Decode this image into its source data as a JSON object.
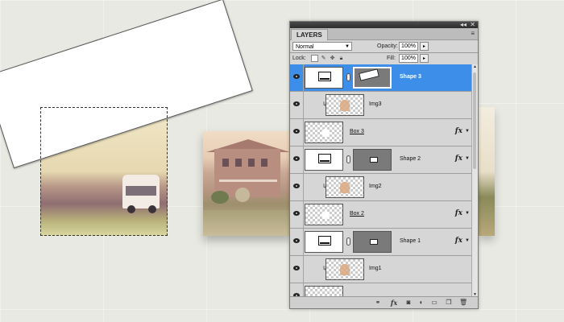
{
  "panel": {
    "tab_label": "LAYERS",
    "topbar_controls": [
      "◂◂",
      "✕"
    ],
    "menu_icon": "≡",
    "blend_mode": "Normal",
    "opacity_label": "Opacity:",
    "opacity_value": "100%",
    "lock_label": "Lock:",
    "fill_label": "Fill:",
    "fill_value": "100%",
    "lock_icons": [
      "lock-transparent-icon",
      "lock-brush-icon",
      "lock-position-icon",
      "lock-all-icon"
    ],
    "bottom_icons": [
      "link-icon",
      "fx-icon",
      "mask-icon",
      "adjustment-icon",
      "group-folder-icon",
      "new-layer-icon",
      "trash-icon"
    ]
  },
  "layers": [
    {
      "name": "Shape 3",
      "selected": true,
      "type": "shape",
      "has_mask": true,
      "fx": false
    },
    {
      "name": "Img3",
      "selected": false,
      "type": "image",
      "clipped": true,
      "fx": false
    },
    {
      "name": "Box 3",
      "selected": false,
      "type": "box",
      "fx": true
    },
    {
      "name": "Shape 2",
      "selected": false,
      "type": "shape",
      "has_mask": true,
      "fx": true
    },
    {
      "name": "Img2",
      "selected": false,
      "type": "image",
      "clipped": true,
      "fx": false
    },
    {
      "name": "Box 2",
      "selected": false,
      "type": "box",
      "fx": true
    },
    {
      "name": "Shape 1",
      "selected": false,
      "type": "shape",
      "has_mask": true,
      "fx": true
    },
    {
      "name": "Img1",
      "selected": false,
      "type": "image",
      "clipped": true,
      "fx": false
    },
    {
      "name": "",
      "selected": false,
      "type": "partial",
      "fx": false
    }
  ],
  "colors": {
    "selection": "#3d8ee8",
    "panel_bg": "#d6d6d6",
    "canvas_bg": "#e8e9e2"
  }
}
